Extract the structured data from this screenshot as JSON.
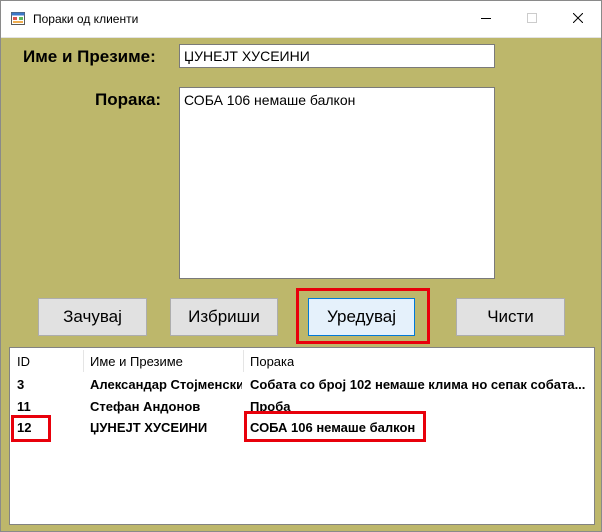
{
  "window": {
    "title": "Пораки од клиенти",
    "controls": {
      "minimize": "—",
      "close": "✕"
    }
  },
  "form": {
    "name_label": "Име и Презиме:",
    "name_value": "ЏУНЕЈТ ХУСЕИНИ",
    "message_label": "Порака:",
    "message_value": "СОБА 106 немаше балкон"
  },
  "buttons": {
    "save": "Зачувај",
    "delete": "Избриши",
    "edit": "Уредувај",
    "clear": "Чисти"
  },
  "table": {
    "columns": [
      "ID",
      "Име и Презиме",
      "Порака"
    ],
    "rows": [
      [
        "3",
        "Александар Стојменски",
        "Собата со број 102 немаше клима но сепак собата..."
      ],
      [
        "11",
        "Стефан Андонов",
        "Проба"
      ],
      [
        "12",
        "ЏУНЕЈТ ХУСЕИНИ",
        "СОБА 106 немаше балкон"
      ]
    ]
  },
  "colors": {
    "form_background": "#bdb76b",
    "highlight": "#e8000b",
    "focus_border": "#0078d7"
  }
}
